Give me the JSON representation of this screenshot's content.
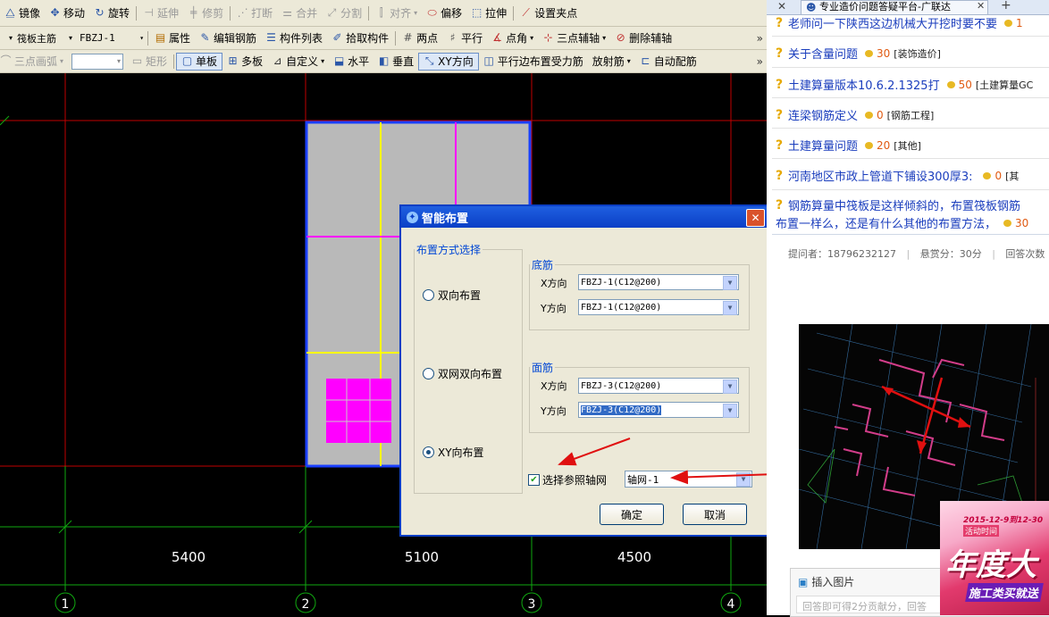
{
  "toolbar1": {
    "items": [
      {
        "label": "镜像",
        "icon": "mirror-icon",
        "enabled": true
      },
      {
        "label": "移动",
        "icon": "move-icon",
        "enabled": true
      },
      {
        "label": "旋转",
        "icon": "rotate-icon",
        "enabled": true
      },
      {
        "label": "延伸",
        "icon": "extend-icon",
        "enabled": false
      },
      {
        "label": "修剪",
        "icon": "trim-icon",
        "enabled": false
      },
      {
        "label": "打断",
        "icon": "break-icon",
        "enabled": false
      },
      {
        "label": "合并",
        "icon": "merge-icon",
        "enabled": false
      },
      {
        "label": "分割",
        "icon": "split-icon",
        "enabled": false
      },
      {
        "label": "对齐",
        "icon": "align-icon",
        "enabled": false
      },
      {
        "label": "偏移",
        "icon": "offset-icon",
        "enabled": true
      },
      {
        "label": "拉伸",
        "icon": "stretch-icon",
        "enabled": true
      },
      {
        "label": "设置夹点",
        "icon": "grip-icon",
        "enabled": true
      }
    ]
  },
  "toolbar2": {
    "type_combo": "筏板主筋",
    "name_combo": "FBZJ-1",
    "items": [
      {
        "label": "属性",
        "icon": "property-icon"
      },
      {
        "label": "编辑钢筋",
        "icon": "edit-rebar-icon"
      },
      {
        "label": "构件列表",
        "icon": "list-icon"
      },
      {
        "label": "拾取构件",
        "icon": "pick-icon"
      },
      {
        "label": "两点",
        "icon": "two-point-icon"
      },
      {
        "label": "平行",
        "icon": "parallel-icon"
      },
      {
        "label": "点角",
        "icon": "point-angle-icon"
      },
      {
        "label": "三点辅轴",
        "icon": "three-point-axis-icon"
      },
      {
        "label": "删除辅轴",
        "icon": "delete-axis-icon"
      }
    ],
    "more": "»"
  },
  "toolbar3": {
    "disabled_items": [
      "三点画弧",
      "矩形"
    ],
    "items": [
      {
        "label": "单板",
        "icon": "single-plate-icon",
        "selected": true
      },
      {
        "label": "多板",
        "icon": "multi-plate-icon",
        "selected": false
      },
      {
        "label": "自定义",
        "icon": "custom-icon",
        "selected": false
      },
      {
        "label": "水平",
        "icon": "horizontal-icon",
        "selected": false
      },
      {
        "label": "垂直",
        "icon": "vertical-icon",
        "selected": false
      },
      {
        "label": "XY方向",
        "icon": "xy-direction-icon",
        "selected": true
      },
      {
        "label": "平行边布置受力筋",
        "icon": "parallel-edge-icon",
        "selected": false
      },
      {
        "label": "放射筋",
        "icon": "radial-icon",
        "selected": false
      },
      {
        "label": "自动配筋",
        "icon": "auto-rebar-icon",
        "selected": false
      }
    ],
    "more": "»"
  },
  "canvas": {
    "dimensions": [
      "5400",
      "5100",
      "4500"
    ],
    "axes": [
      "1",
      "2",
      "3",
      "4"
    ],
    "colors": {
      "grid": "#c00000",
      "axis": "#10a810",
      "slab": "#b9b9b9",
      "border": "#1a3fff",
      "yellow": "#ffff00",
      "magenta": "#ff00ff"
    }
  },
  "dialog": {
    "title": "智能布置",
    "group_mode": "布置方式选择",
    "modes": [
      {
        "label": "双向布置",
        "checked": false
      },
      {
        "label": "双网双向布置",
        "checked": false
      },
      {
        "label": "XY向布置",
        "checked": true
      }
    ],
    "bottom_group": "底筋",
    "top_group": "面筋",
    "x_label": "X方向",
    "y_label": "Y方向",
    "bottom_x": "FBZJ-1(C12@200)",
    "bottom_y": "FBZJ-1(C12@200)",
    "top_x": "FBZJ-3(C12@200)",
    "top_y": "FBZJ-3(C12@200)",
    "ref_axis_label": "选择参照轴网",
    "ref_axis_checked": true,
    "ref_axis_value": "轴网-1",
    "ok": "确定",
    "cancel": "取消"
  },
  "browser": {
    "tab_title": "专业造价问题答疑平台-广联达",
    "questions": [
      {
        "title": "老师问一下陕西这边机械大开挖时要不要",
        "points": "1",
        "category": ""
      },
      {
        "title": "关于含量问题",
        "points": "30",
        "category": "[装饰造价]"
      },
      {
        "title": "土建算量版本10.6.2.1325打",
        "points": "50",
        "category": "[土建算量GC"
      },
      {
        "title": "连梁钢筋定义",
        "points": "0",
        "category": "[钢筋工程]"
      },
      {
        "title": "土建算量问题",
        "points": "20",
        "category": "[其他]"
      },
      {
        "title": "河南地区市政上管道下铺设300厚3:",
        "points": "0",
        "category": "[其"
      }
    ],
    "long_question": {
      "line1": "钢筋算量中筏板是这样倾斜的，布置筏板钢筋",
      "line2": "布置一样么，还是有什么其他的布置方法，",
      "points": "30"
    },
    "meta": {
      "asker": "提问者：18796232127",
      "reward": "悬赏分：30分",
      "answers": "回答次数"
    },
    "insert_image": "插入图片",
    "answer_placeholder": "回答即可得2分贡献分，回答",
    "ad": {
      "date": "2015-12-9到12-30",
      "subtitle": "活动时间",
      "title": "年度大",
      "slogan": "施工类买就送"
    }
  }
}
